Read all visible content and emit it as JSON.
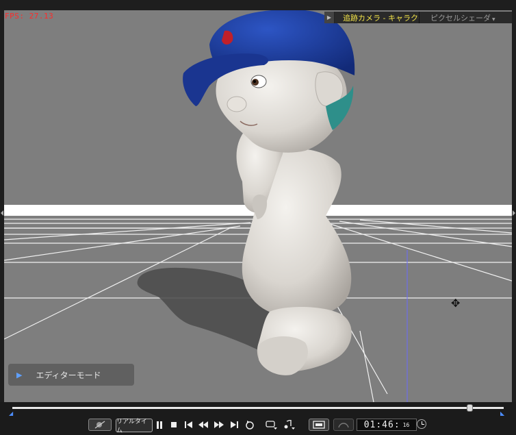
{
  "viewport": {
    "fps_text": "FPS: 27.13",
    "camera_select": "追跡カメラ - キャラクタ",
    "shader_select": "ピクセルシェーダ",
    "editor_mode_label": "エディターモード"
  },
  "playback": {
    "position_fraction": 0.93,
    "realtime_label": "リアルタイム",
    "timecode": "01:46:",
    "timecode_frames": "16"
  },
  "colors": {
    "fps_red": "#ff2a2a",
    "camera_yellow": "#f2e34a",
    "accent_blue": "#4c8dff",
    "cap_blue": "#1f3f9e",
    "skin": "#e2ded8"
  },
  "icons": {
    "camera_toggle": "play-right-icon",
    "editor_mode": "play-triangle-icon",
    "move_cursor": "four-way-arrow-icon",
    "clock": "clock-icon"
  }
}
